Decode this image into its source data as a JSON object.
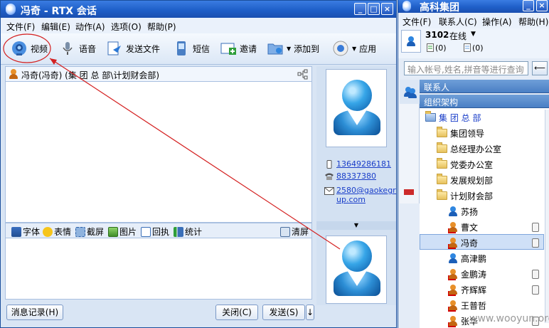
{
  "chat_window": {
    "title": "冯奇 - RTX 会话",
    "menu": [
      "文件(F)",
      "编辑(E)",
      "动作(A)",
      "选项(O)",
      "帮助(P)"
    ],
    "toolbar": {
      "video": "视频",
      "voice": "语音",
      "send_file": "发送文件",
      "sms": "短信",
      "invite": "邀请",
      "add_to": "添加到",
      "apps": "应用"
    },
    "contact_path": "冯奇(冯奇) (集 团 总 部\\计划财会部)",
    "format_bar": [
      "字体",
      "表情",
      "截屏",
      "图片",
      "回执",
      "统计"
    ],
    "clear_label": "清屏",
    "history_button": "消息记录(H)",
    "close_button": "关闭(C)",
    "send_button": "发送(S)",
    "send_arrow": "↓",
    "contact_info": {
      "mobile": "13649286181",
      "phone": "88337380",
      "email_line1": "2580@gaokegro",
      "email_line2": "up.com"
    }
  },
  "rtx_window": {
    "title": "高科集团",
    "menu": [
      "文件(F)",
      "联系人(C)",
      "操作(A)",
      "帮助(H)"
    ],
    "user_id": "3102",
    "status": "在线",
    "counter_a": "(0)",
    "counter_b": "(0)",
    "search_placeholder": "输入帐号,姓名,拼音等进行查询",
    "section_contacts": "联系人",
    "section_org": "组织架构",
    "tree": {
      "root": "集 团 总 部",
      "folders": [
        "集团领导",
        "总经理办公室",
        "党委办公室",
        "发展规划部",
        "计划财会部"
      ],
      "members": [
        "苏扬",
        "曹文",
        "冯奇",
        "高津鹏",
        "金鹏涛",
        "齐辉辉",
        "王普哲",
        "张华"
      ]
    }
  },
  "watermark": "www.wooyun.org",
  "colors": {
    "titlebar": "#1f5fc8",
    "selected_row": "#cfe0f7",
    "annotation": "#d42020",
    "link": "#1a3ec9"
  }
}
